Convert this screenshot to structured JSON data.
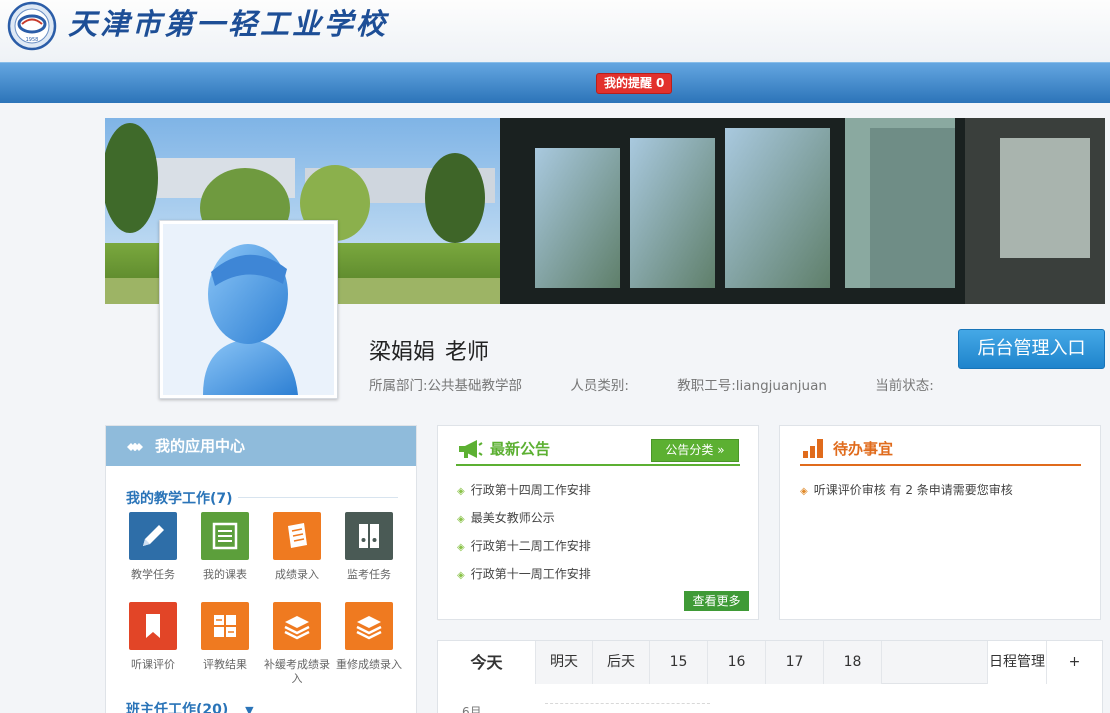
{
  "header": {
    "school_name": "天津市第一轻工业学校",
    "logo_text": "1958"
  },
  "nav": {
    "reminder_label": "我的提醒",
    "reminder_count": "0"
  },
  "profile": {
    "name": "梁娟娟",
    "title": "老师",
    "department": "所属部门:公共基础教学部",
    "staff_type": "人员类别:",
    "staff_id": "教职工号:liangjuanjuan",
    "status": "当前状态:",
    "admin_button": "后台管理入口"
  },
  "app_center": {
    "title": "我的应用中心",
    "teaching_section": "我的教学工作(7)",
    "homeroom_section": "班主任工作(20)",
    "apps": [
      {
        "label": "教学任务",
        "icon": "pencil-icon",
        "color": "#2e6ea8"
      },
      {
        "label": "我的课表",
        "icon": "schedule-icon",
        "color": "#5c9f3b"
      },
      {
        "label": "成绩录入",
        "icon": "score-entry-icon",
        "color": "#ef7a20"
      },
      {
        "label": "监考任务",
        "icon": "binder-icon",
        "color": "#4a5a55"
      },
      {
        "label": "听课评价",
        "icon": "bookmark-icon",
        "color": "#e24527"
      },
      {
        "label": "评教结果",
        "icon": "calculator-icon",
        "color": "#ef7a20"
      },
      {
        "label": "补缓考成绩录入",
        "icon": "stack-icon",
        "color": "#ef7a20"
      },
      {
        "label": "重修成绩录入",
        "icon": "stack-icon",
        "color": "#ef7a20"
      }
    ]
  },
  "notices": {
    "title": "最新公告",
    "category_button": "公告分类 »",
    "items": [
      "行政第十四周工作安排",
      "最美女教师公示",
      "行政第十二周工作安排",
      "行政第十一周工作安排"
    ],
    "more_button": "查看更多",
    "accent_color": "#5cb032"
  },
  "todo": {
    "title": "待办事宜",
    "items": [
      "听课评价审核 有 2 条申请需要您审核"
    ],
    "accent_color": "#e06b1c"
  },
  "calendar": {
    "tabs": [
      "今天",
      "明天",
      "后天",
      "15",
      "16",
      "17",
      "18"
    ],
    "schedule_button": "日程管理",
    "add_button": "+",
    "month": "6月"
  }
}
